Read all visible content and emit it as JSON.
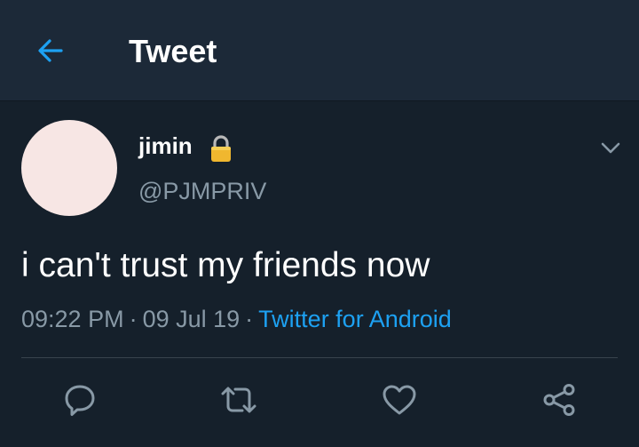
{
  "appbar": {
    "title": "Tweet",
    "back_icon": "arrow-left-icon"
  },
  "colors": {
    "background": "#15202b",
    "appbar": "#1c2938",
    "accent": "#1da1f2",
    "secondary_text": "#8899a6",
    "avatar_fill": "#f7e6e4"
  },
  "tweet": {
    "author": {
      "display_name": "jimin",
      "handle": "@PJMPRIV",
      "protected_icon": "lock-icon"
    },
    "text": "i can't trust my friends now",
    "time": "09:22 PM",
    "date": "09 Jul 19",
    "source": "Twitter for Android",
    "separator": "·",
    "menu_icon": "chevron-down-icon"
  },
  "actions": [
    {
      "name": "reply",
      "icon": "reply-icon"
    },
    {
      "name": "retweet",
      "icon": "retweet-icon"
    },
    {
      "name": "like",
      "icon": "heart-icon"
    },
    {
      "name": "share",
      "icon": "share-icon"
    }
  ]
}
